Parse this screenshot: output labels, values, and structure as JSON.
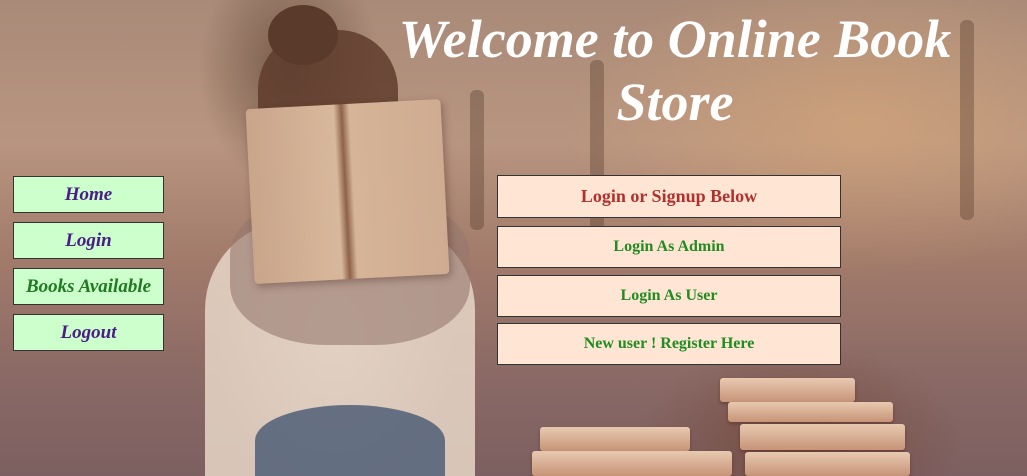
{
  "header": {
    "title": "Welcome to Online Book Store"
  },
  "nav": {
    "items": [
      {
        "label": "Home"
      },
      {
        "label": "Login"
      },
      {
        "label": "Books Available"
      },
      {
        "label": "Logout"
      }
    ]
  },
  "panel": {
    "heading": "Login or Signup Below",
    "buttons": [
      {
        "label": "Login As Admin"
      },
      {
        "label": "Login As User"
      },
      {
        "label": "New user ! Register Here"
      }
    ]
  },
  "colors": {
    "nav_bg": "#ccffcc",
    "nav_text": "#4b1c86",
    "nav_text_alt": "#217a21",
    "panel_bg": "#ffe6d4",
    "panel_heading_text": "#b0302e",
    "panel_button_text": "#228b22",
    "title_text": "#ffffff"
  }
}
